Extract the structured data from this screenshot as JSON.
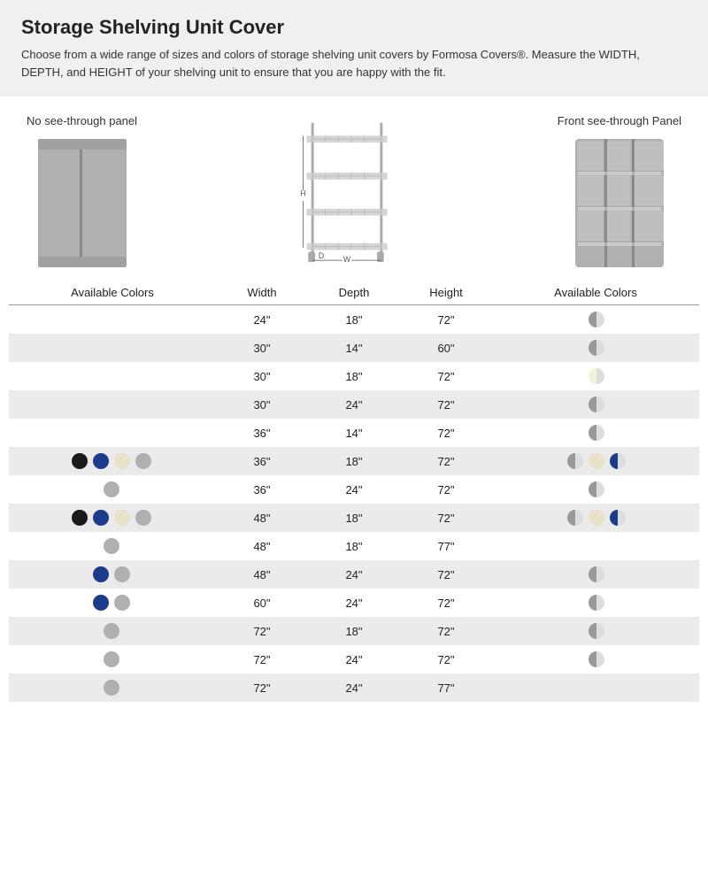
{
  "header": {
    "title": "Storage Shelving Unit Cover",
    "description": "Choose from a wide range of sizes and colors of storage shelving unit covers by Formosa Covers®. Measure the WIDTH, DEPTH, and HEIGHT of your shelving unit to ensure that you are happy with the fit."
  },
  "diagram": {
    "left_label": "No see-through panel",
    "right_label": "Front see-through Panel"
  },
  "table": {
    "col_left_colors": "Available Colors",
    "col_width": "Width",
    "col_depth": "Depth",
    "col_height": "Height",
    "col_right_colors": "Available Colors",
    "rows": [
      {
        "width": "24\"",
        "depth": "18\"",
        "height": "72\"",
        "left_dots": [],
        "right_dots": [
          "half"
        ]
      },
      {
        "width": "30\"",
        "depth": "14\"",
        "height": "60\"",
        "left_dots": [],
        "right_dots": [
          "half"
        ]
      },
      {
        "width": "30\"",
        "depth": "18\"",
        "height": "72\"",
        "left_dots": [],
        "right_dots": [
          "cream-half"
        ]
      },
      {
        "width": "30\"",
        "depth": "24\"",
        "height": "72\"",
        "left_dots": [],
        "right_dots": [
          "half"
        ]
      },
      {
        "width": "36\"",
        "depth": "14\"",
        "height": "72\"",
        "left_dots": [],
        "right_dots": [
          "half"
        ]
      },
      {
        "width": "36\"",
        "depth": "18\"",
        "height": "72\"",
        "left_dots": [
          "black",
          "navy",
          "cream",
          "gray"
        ],
        "right_dots": [
          "half",
          "cream",
          "half-navy"
        ]
      },
      {
        "width": "36\"",
        "depth": "24\"",
        "height": "72\"",
        "left_dots": [
          "gray"
        ],
        "right_dots": [
          "half"
        ]
      },
      {
        "width": "48\"",
        "depth": "18\"",
        "height": "72\"",
        "left_dots": [
          "black",
          "navy",
          "cream",
          "gray"
        ],
        "right_dots": [
          "half",
          "cream",
          "half-navy"
        ]
      },
      {
        "width": "48\"",
        "depth": "18\"",
        "height": "77\"",
        "left_dots": [
          "gray"
        ],
        "right_dots": []
      },
      {
        "width": "48\"",
        "depth": "24\"",
        "height": "72\"",
        "left_dots": [
          "navy",
          "gray"
        ],
        "right_dots": [
          "half"
        ]
      },
      {
        "width": "60\"",
        "depth": "24\"",
        "height": "72\"",
        "left_dots": [
          "navy",
          "gray"
        ],
        "right_dots": [
          "half"
        ]
      },
      {
        "width": "72\"",
        "depth": "18\"",
        "height": "72\"",
        "left_dots": [
          "gray"
        ],
        "right_dots": [
          "half"
        ]
      },
      {
        "width": "72\"",
        "depth": "24\"",
        "height": "72\"",
        "left_dots": [
          "gray"
        ],
        "right_dots": [
          "half"
        ]
      },
      {
        "width": "72\"",
        "depth": "24\"",
        "height": "77\"",
        "left_dots": [
          "gray"
        ],
        "right_dots": []
      }
    ]
  }
}
